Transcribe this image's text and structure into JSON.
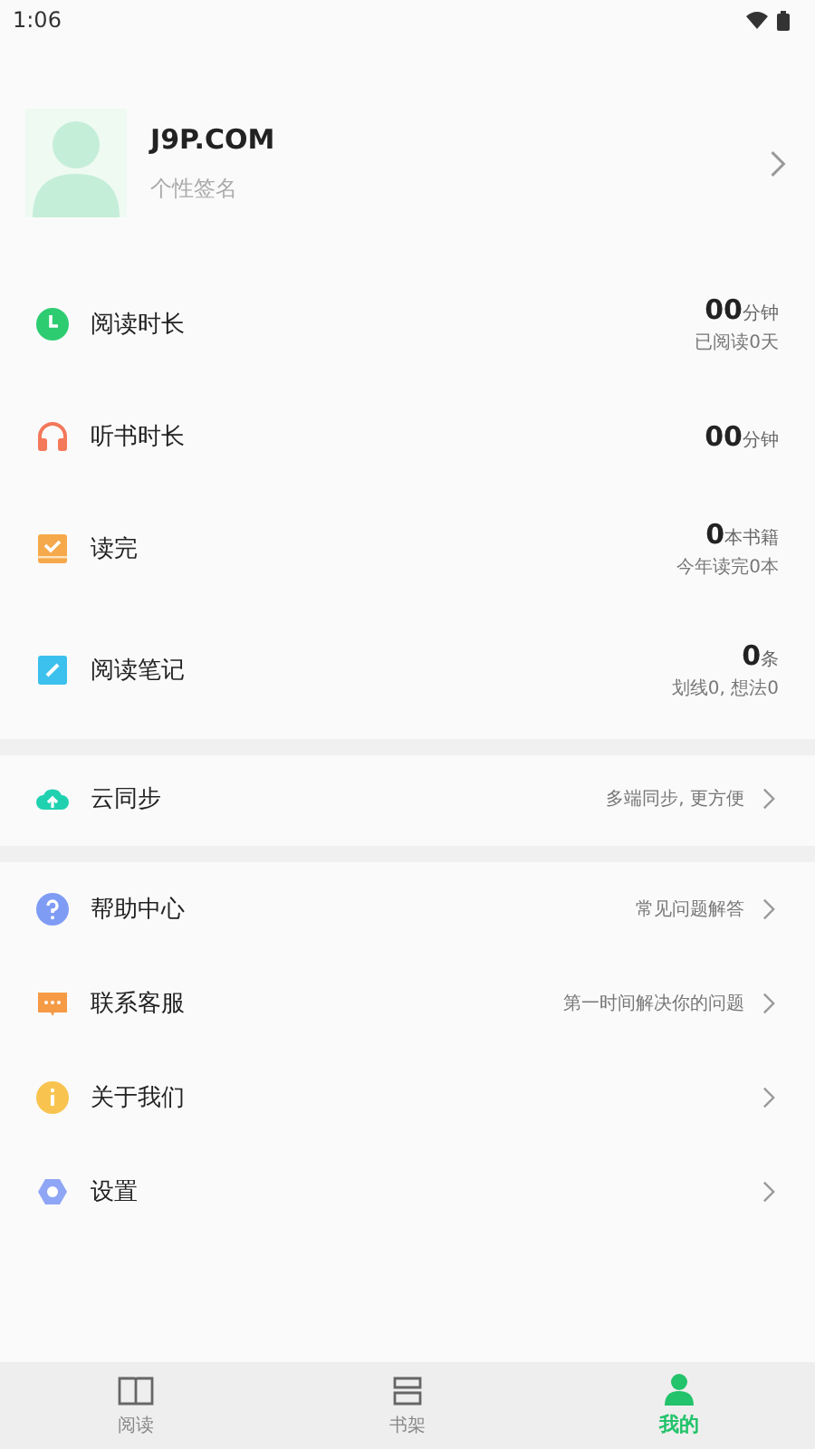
{
  "status_bar": {
    "time": "1:06"
  },
  "profile": {
    "name": "J9P.COM",
    "signature": "个性签名"
  },
  "stats": [
    {
      "label": "阅读时长",
      "value": "00",
      "unit": "分钟",
      "sub": "已阅读0天"
    },
    {
      "label": "听书时长",
      "value": "00",
      "unit": "分钟"
    },
    {
      "label": "读完",
      "value": "0",
      "unit": "本书籍",
      "sub": "今年读完0本"
    },
    {
      "label": "阅读笔记",
      "value": "0",
      "unit": "条",
      "sub": "划线0, 想法0"
    }
  ],
  "sync": {
    "label": "云同步",
    "hint": "多端同步, 更方便"
  },
  "menu": [
    {
      "label": "帮助中心",
      "hint": "常见问题解答"
    },
    {
      "label": "联系客服",
      "hint": "第一时间解决你的问题"
    },
    {
      "label": "关于我们"
    },
    {
      "label": "设置"
    }
  ],
  "tabs": [
    {
      "label": "阅读",
      "selected": false
    },
    {
      "label": "书架",
      "selected": false
    },
    {
      "label": "我的",
      "selected": true
    }
  ]
}
